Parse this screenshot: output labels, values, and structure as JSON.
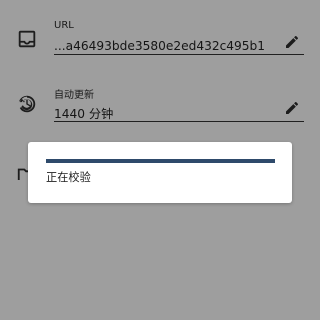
{
  "settings": {
    "url": {
      "label": "URL",
      "value": "...a46493bde3580e2ed432c495b1"
    },
    "auto_update": {
      "label": "自动更新",
      "value": "1440 分钟"
    }
  },
  "dialog": {
    "message": "正在校验",
    "progress": 1.0
  },
  "icons": {
    "url": "inbox-icon",
    "auto_update": "refresh-clock-icon",
    "edit": "pencil-icon",
    "partial": "folder-icon"
  },
  "colors": {
    "scrim": "#9e9e9e",
    "dialog_bg": "#ffffff",
    "progress_fill": "#2e4a6b",
    "progress_track": "#d6dde6"
  }
}
